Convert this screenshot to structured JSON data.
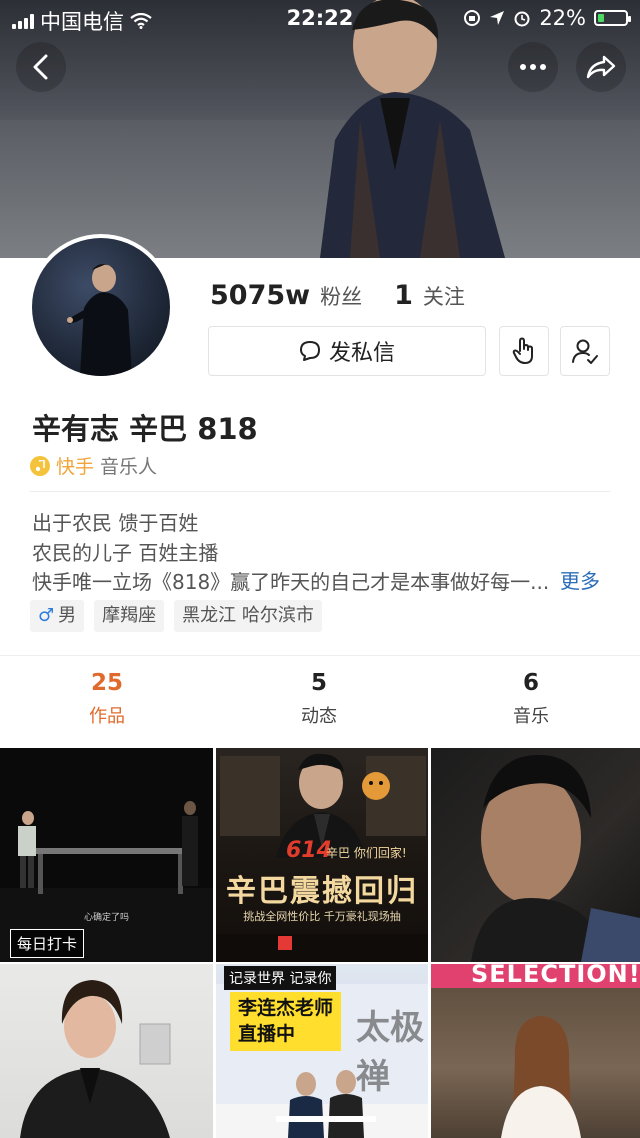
{
  "status_bar": {
    "carrier": "中国电信",
    "time": "22:22",
    "battery": "22%",
    "battery_level": 0.22
  },
  "profile": {
    "followers_count": "5075w",
    "followers_label": "粉丝",
    "following_count": "1",
    "following_label": "关注",
    "message_button": "发私信",
    "name": "辛有志 辛巴 818",
    "badge_prefix": "快手",
    "badge_suffix": "音乐人",
    "bio_lines": [
      "出于农民 馈于百姓",
      "农民的儿子  百姓主播",
      "快手唯一立场《818》赢了昨天的自己才是本事做好每一..."
    ],
    "bio_more": "更多",
    "tags": [
      "男",
      "摩羯座",
      "黑龙江 哈尔滨市"
    ]
  },
  "tabs": [
    {
      "count": "25",
      "label": "作品",
      "active": true
    },
    {
      "count": "5",
      "label": "动态",
      "active": false
    },
    {
      "count": "6",
      "label": "音乐",
      "active": false
    }
  ],
  "grid": {
    "cell1_label": "每日打卡",
    "cell1_caption": "心确定了吗",
    "cell2_num": "614",
    "cell2_title": "辛巴震撼回归",
    "cell2_slogan": "辛巴 你们回家!",
    "cell2_sub": "挑战全网性价比    千万豪礼现场抽",
    "cell5_tag": "记录世界 记录你",
    "cell5_line1": "李连杰老师",
    "cell5_line2": "直播中",
    "cell5_bg_text": "太极禅",
    "cell6_title": "SELECTION!"
  },
  "colors": {
    "accent": "#e06a2c",
    "link": "#2b6cb8",
    "badge": "#f5c23b"
  }
}
